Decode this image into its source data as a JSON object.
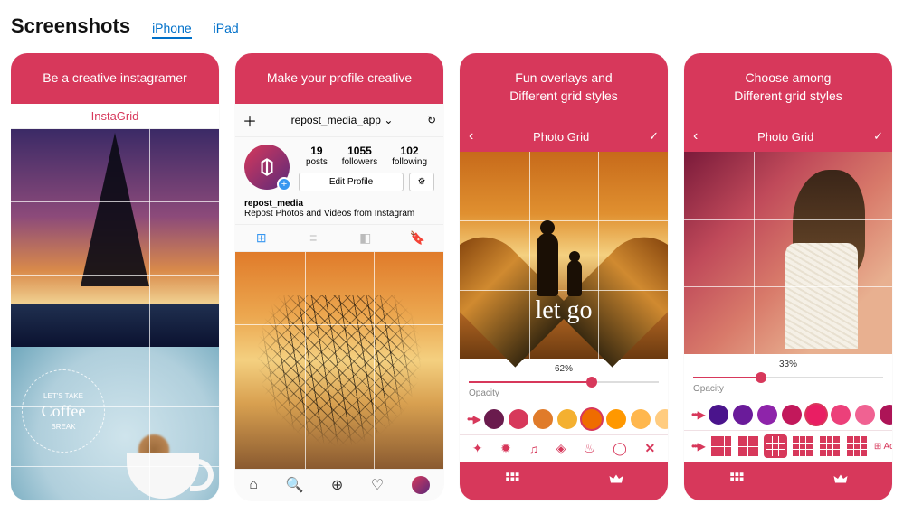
{
  "header": {
    "title": "Screenshots",
    "tabs": [
      "iPhone",
      "iPad"
    ],
    "active_tab": 0
  },
  "shots": [
    {
      "caption": "Be a creative instagramer",
      "app_title": "InstaGrid",
      "badge": {
        "top": "LET'S TAKE",
        "script": "Coffee",
        "bottom": "BREAK"
      }
    },
    {
      "caption": "Make your profile creative",
      "profile": {
        "handle_header": "repost_media_app",
        "username": "repost_media",
        "bio": "Repost Photos and Videos from Instagram",
        "stats": [
          {
            "n": "19",
            "l": "posts"
          },
          {
            "n": "1055",
            "l": "followers"
          },
          {
            "n": "102",
            "l": "following"
          }
        ],
        "edit_label": "Edit Profile"
      }
    },
    {
      "caption_line1": "Fun overlays and",
      "caption_line2": "Different grid styles",
      "toolbar_title": "Photo Grid",
      "overlay_text": "let go",
      "slider": {
        "percent": "62%",
        "value": 62,
        "label": "Opacity"
      },
      "swatches": [
        "#6a1b4d",
        "#d7385b",
        "#e07b2a",
        "#f4b030",
        "#ef6c00",
        "#ff9800",
        "#ffb74d",
        "#ffcc80"
      ],
      "selected_swatch": 4,
      "icons": [
        "sparkle",
        "burst",
        "music",
        "diamond",
        "grill",
        "ring",
        "close"
      ]
    },
    {
      "caption_line1": "Choose among",
      "caption_line2": "Different grid styles",
      "toolbar_title": "Photo Grid",
      "slider": {
        "percent": "33%",
        "value": 33,
        "label": "Opacity"
      },
      "swatches": [
        "#4a148c",
        "#6a1b9a",
        "#8e24aa",
        "#c2185b",
        "#e91e63",
        "#ec407a",
        "#f06292",
        "#ad1457"
      ],
      "selected_swatch": 4,
      "grid_styles": [
        "2x2a",
        "2x2b",
        "3x3",
        "3x3b",
        "3x3c",
        "3x3d"
      ],
      "selected_grid": 2,
      "add_label": "Add"
    }
  ]
}
